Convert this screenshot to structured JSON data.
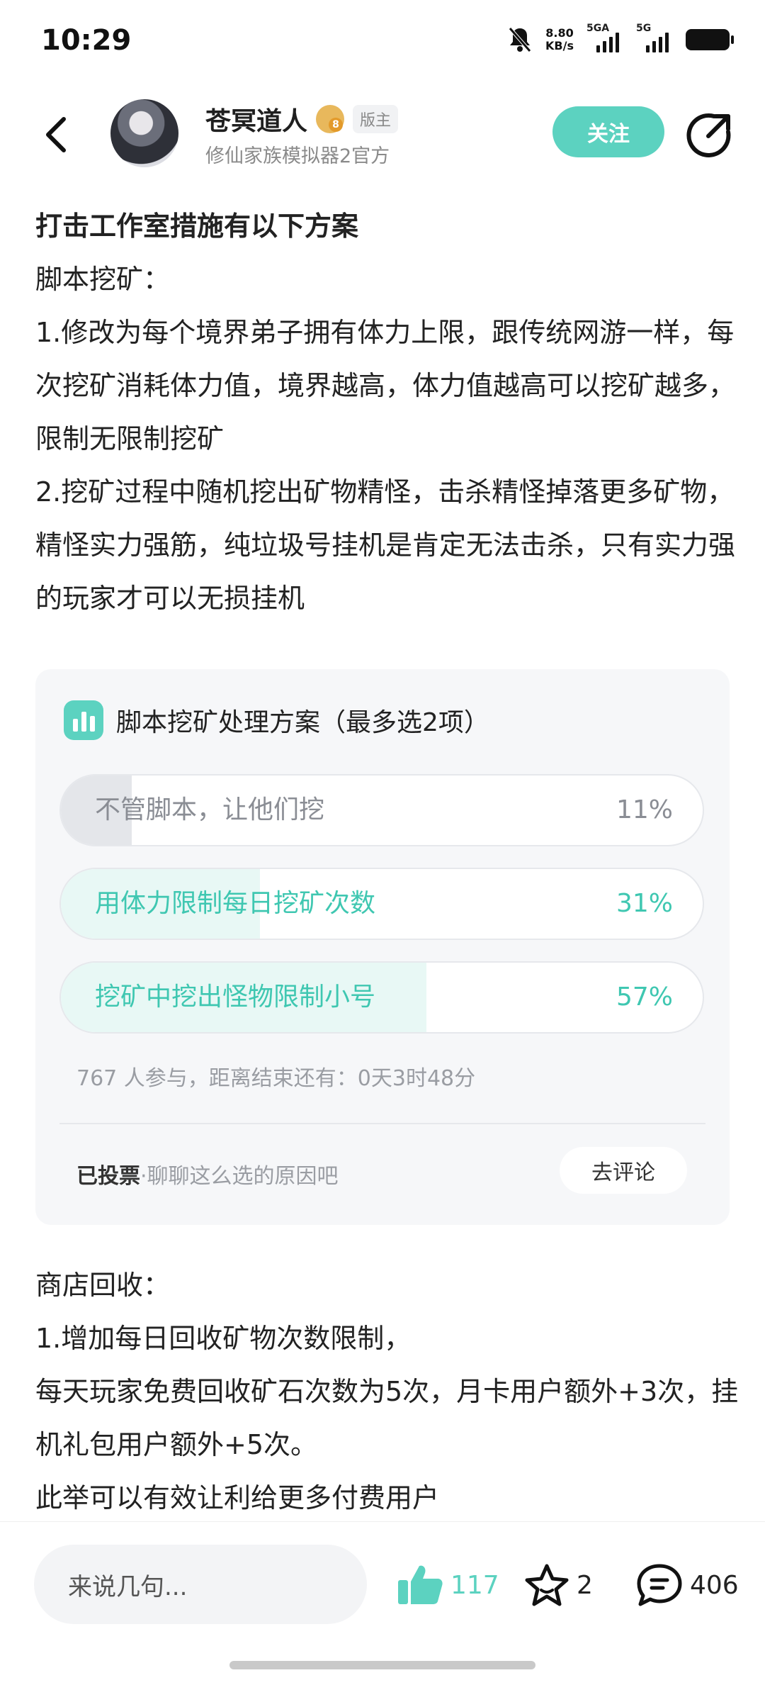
{
  "status": {
    "time": "10:29",
    "net_speed_value": "8.80",
    "net_speed_unit": "KB/s",
    "sim1": "5GA",
    "sim2": "5G"
  },
  "header": {
    "author_name": "苍冥道人",
    "level": "8",
    "role_badge": "版主",
    "subtitle": "修仙家族模拟器2官方",
    "follow_label": "关注"
  },
  "article": {
    "title": "打击工作室措施有以下方案",
    "section1_heading": "脚本挖矿：",
    "paragraph1": "1.修改为每个境界弟子拥有体力上限，跟传统网游一样，每次挖矿消耗体力值，境界越高，体力值越高可以挖矿越多，限制无限制挖矿",
    "paragraph2": "2.挖矿过程中随机挖出矿物精怪，击杀精怪掉落更多矿物，精怪实力强筋，纯垃圾号挂机是肯定无法击杀，只有实力强的玩家才可以无损挂机"
  },
  "poll": {
    "title": "脚本挖矿处理方案（最多选2项）",
    "options": [
      {
        "label": "不管脚本，让他们挖",
        "percent": "11%",
        "value": 11
      },
      {
        "label": "用体力限制每日挖矿次数",
        "percent": "31%",
        "value": 31
      },
      {
        "label": "挖矿中挖出怪物限制小号",
        "percent": "57%",
        "value": 57
      }
    ],
    "info": "767 人参与，距离结束还有：0天3时48分",
    "voted_label": "已投票",
    "voted_hint": "·聊聊这么选的原因吧",
    "comment_button": "去评论"
  },
  "article2": {
    "heading": "商店回收：",
    "line1": "1.增加每日回收矿物次数限制，",
    "line2": "每天玩家免费回收矿石次数为5次，月卡用户额外+3次，挂机礼包用户额外+5次。",
    "line3": "此举可以有效让利给更多付费用户"
  },
  "bottom": {
    "comment_placeholder": "来说几句...",
    "likes": "117",
    "favorites": "2",
    "comments": "406"
  },
  "colors": {
    "accent": "#5cd2c0",
    "accent_text": "#3fc7b1"
  }
}
